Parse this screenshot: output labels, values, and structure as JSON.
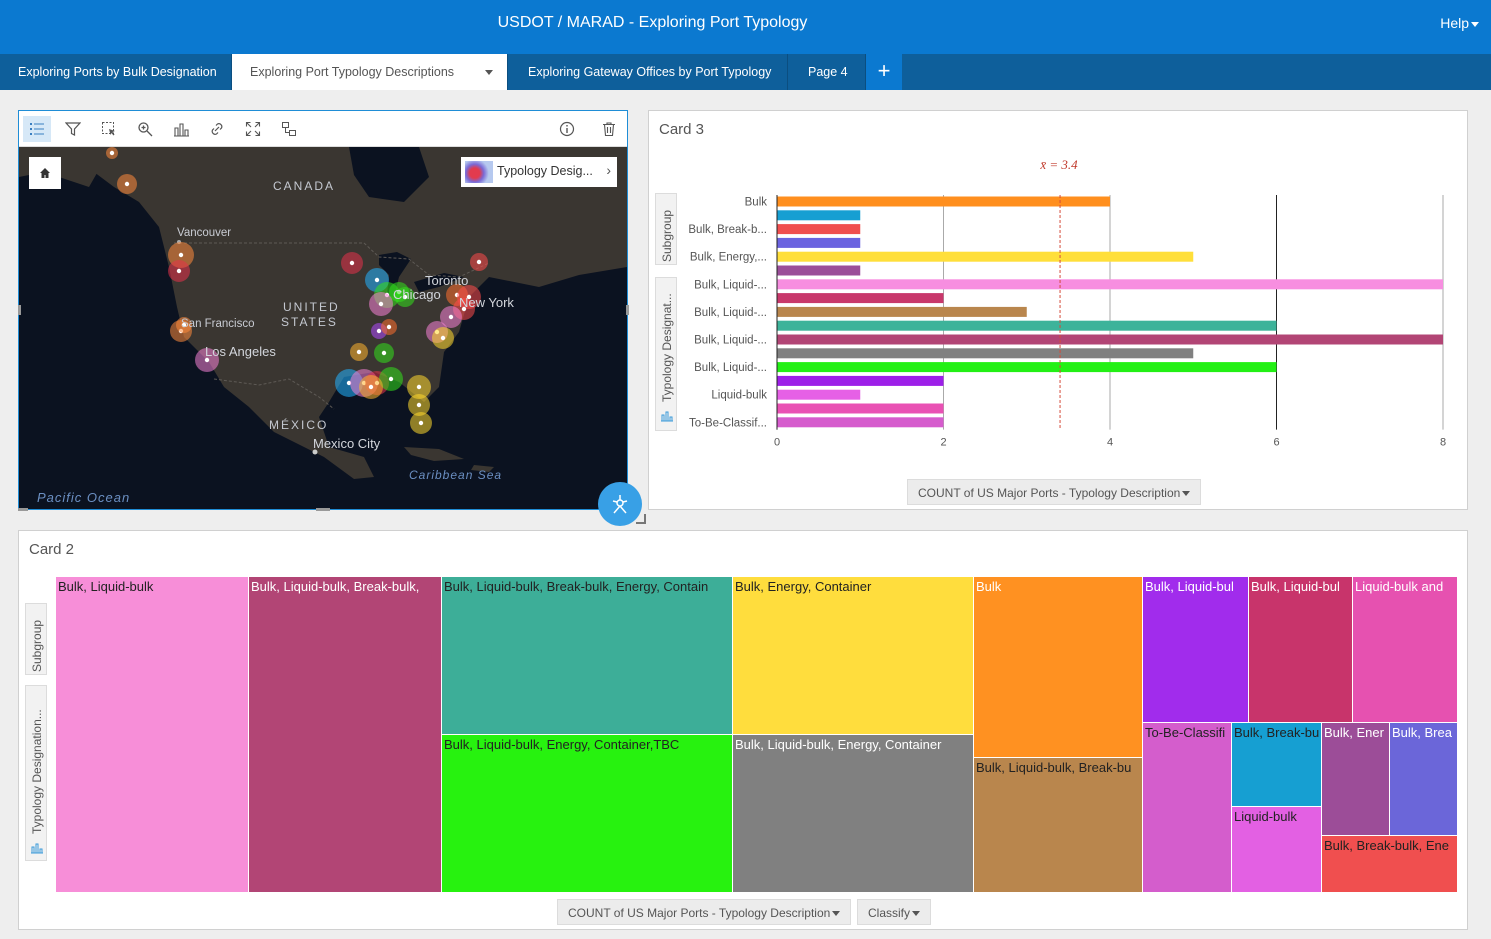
{
  "header": {
    "title": "USDOT / MARAD - Exploring Port Typology",
    "help_label": "Help"
  },
  "tabs": [
    {
      "label": "Exploring Ports by Bulk Designation",
      "active": false
    },
    {
      "label": "Exploring Port Typology Descriptions",
      "active": true
    },
    {
      "label": "Exploring Gateway Offices by Port Typology",
      "active": false
    },
    {
      "label": "Page 4",
      "active": false
    }
  ],
  "map_card": {
    "legend_label": "Typology Desig...",
    "labels": {
      "canada": "CANADA",
      "united": "UNITED",
      "states": "STATES",
      "mexico": "MÉXICO",
      "vancouver": "Vancouver",
      "toronto": "Toronto",
      "chicago": "Chicago",
      "new_york": "New York",
      "san_francisco": "San Francisco",
      "los_angeles": "Los Angeles",
      "mexico_city": "Mexico City",
      "caribbean": "Caribbean Sea",
      "pacific": "Pacific Ocean"
    },
    "port_colors": [
      "#ff8a3d",
      "#ff4a4a",
      "#e6324b",
      "#22b2ff",
      "#33e01c",
      "#f582d6",
      "#ffd92e",
      "#b04aff",
      "#e05bd6",
      "#ff6f2e",
      "#ffb52e"
    ]
  },
  "bar_card": {
    "title": "Card 3",
    "mean_label": "x̄ = 3.4",
    "subgroup_tab": "Subgroup",
    "typology_tab": "Typology Designat...",
    "field_button": "COUNT of US Major Ports - Typology Description",
    "chart_data": {
      "type": "bar",
      "orientation": "horizontal",
      "category_labels": [
        "Bulk",
        "Bulk, Break-b...",
        "Bulk, Energy,...",
        "Bulk, Liquid-...",
        "Bulk, Liquid-...",
        "Bulk, Liquid-...",
        "Bulk, Liquid-...",
        "Liquid-bulk",
        "To-Be-Classif..."
      ],
      "values": [
        4,
        1,
        1,
        1,
        5,
        1,
        8,
        2,
        3,
        6,
        8,
        5,
        6,
        2,
        1,
        2,
        2
      ],
      "colors": [
        "#ff8f1e",
        "#169fd2",
        "#f04f4f",
        "#6b63e0",
        "#ffdf3a",
        "#9b4e99",
        "#f78ee0",
        "#c8386b",
        "#b9864d",
        "#3db39a",
        "#b24575",
        "#808080",
        "#23f015",
        "#9d1fe8",
        "#e660e6",
        "#e951b4",
        "#d65ccd"
      ],
      "xticks": [
        0,
        2,
        4,
        6,
        8
      ],
      "xlim": [
        0,
        8
      ],
      "mean": 3.4
    }
  },
  "tree_card": {
    "title": "Card 2",
    "subgroup_tab": "Subgroup",
    "typology_tab": "Typology Designation...",
    "field_button": "COUNT of US Major Ports - Typology Description",
    "classify_button": "Classify",
    "cells": [
      {
        "label": "Bulk, Liquid-bulk",
        "color": "#f78ed8",
        "dark": false
      },
      {
        "label": "Bulk, Liquid-bulk, Break-bulk, ",
        "color": "#b24575",
        "dark": true
      },
      {
        "label": "Bulk, Liquid-bulk, Break-bulk, Energy, Contain",
        "color": "#3dae98",
        "dark": false
      },
      {
        "label": "Bulk, Liquid-bulk, Energy, Container,TBC",
        "color": "#27f20f",
        "dark": false
      },
      {
        "label": "Bulk, Energy, Container",
        "color": "#ffdd3d",
        "dark": false
      },
      {
        "label": "Bulk, Liquid-bulk, Energy, Container",
        "color": "#808080",
        "dark": true
      },
      {
        "label": "Bulk",
        "color": "#ff9121",
        "dark": true
      },
      {
        "label": "Bulk, Liquid-bulk, Break-bu",
        "color": "#b9864d",
        "dark": false
      },
      {
        "label": "Bulk, Liquid-bul",
        "color": "#a12cec",
        "dark": true
      },
      {
        "label": "Bulk, Liquid-bul",
        "color": "#c8346b",
        "dark": true
      },
      {
        "label": "Liquid-bulk and",
        "color": "#e651b0",
        "dark": true
      },
      {
        "label": "To-Be-Classifi",
        "color": "#d45dcc",
        "dark": false
      },
      {
        "label": "Bulk, Break-bu",
        "color": "#169fd2",
        "dark": false
      },
      {
        "label": "Liquid-bulk",
        "color": "#e360e3",
        "dark": false
      },
      {
        "label": "Bulk, Ener",
        "color": "#9c4d98",
        "dark": true
      },
      {
        "label": "Bulk, Brea",
        "color": "#6b66d9",
        "dark": true
      },
      {
        "label": "Bulk, Break-bulk, Ene",
        "color": "#f04f4f",
        "dark": false
      }
    ]
  }
}
